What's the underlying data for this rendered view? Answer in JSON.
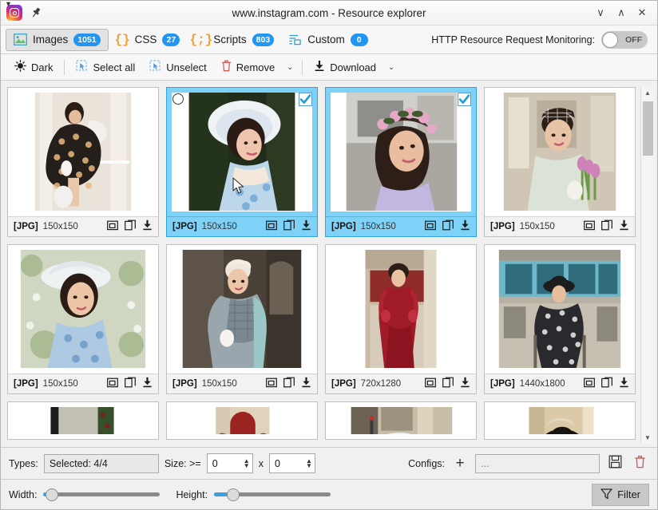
{
  "window": {
    "title": "www.instagram.com - Resource explorer",
    "app_icon": "instagram-logo-icon",
    "pin_icon": "pin-icon",
    "controls": [
      {
        "name": "minimize-button",
        "glyph": "∨"
      },
      {
        "name": "maximize-button",
        "glyph": "∧"
      },
      {
        "name": "close-button",
        "glyph": "✕"
      }
    ]
  },
  "tabs": [
    {
      "id": "images",
      "label": "Images",
      "count": "1051",
      "icon": "image-icon",
      "active": true
    },
    {
      "id": "css",
      "label": "CSS",
      "count": "27",
      "icon": "braces-icon",
      "active": false
    },
    {
      "id": "scripts",
      "label": "Scripts",
      "count": "803",
      "icon": "braces-icon",
      "active": false
    },
    {
      "id": "custom",
      "label": "Custom",
      "count": "0",
      "icon": "list-icon",
      "active": false
    }
  ],
  "http_monitoring": {
    "label": "HTTP Resource Request Monitoring:",
    "state_label": "OFF",
    "enabled": false
  },
  "toolbar": {
    "dark_label": "Dark",
    "select_all_label": "Select all",
    "unselect_label": "Unselect",
    "remove_label": "Remove",
    "download_label": "Download",
    "dropdown_glyph": "⌄"
  },
  "cards": [
    {
      "type": "[JPG]",
      "dims": "150x150",
      "selected": false,
      "checked": false,
      "scene": "dress-floral",
      "cursor": false
    },
    {
      "type": "[JPG]",
      "dims": "150x150",
      "selected": true,
      "checked": true,
      "scene": "white-hat",
      "cursor": true
    },
    {
      "type": "[JPG]",
      "dims": "150x150",
      "selected": true,
      "checked": true,
      "scene": "flower-crown",
      "cursor": false
    },
    {
      "type": "[JPG]",
      "dims": "150x150",
      "selected": false,
      "checked": false,
      "scene": "tulips",
      "cursor": false
    },
    {
      "type": "[JPG]",
      "dims": "150x150",
      "selected": false,
      "checked": false,
      "scene": "garden-hat",
      "cursor": false
    },
    {
      "type": "[JPG]",
      "dims": "150x150",
      "selected": false,
      "checked": false,
      "scene": "gray-coat",
      "cursor": false
    },
    {
      "type": "[JPG]",
      "dims": "720x1280",
      "selected": false,
      "checked": false,
      "scene": "red-dress",
      "cursor": false
    },
    {
      "type": "[JPG]",
      "dims": "1440x1800",
      "selected": false,
      "checked": false,
      "scene": "street-cafe",
      "cursor": false
    }
  ],
  "partial_cards": [
    {
      "scene": "window-green"
    },
    {
      "scene": "red-door"
    },
    {
      "scene": "white-hat-street"
    },
    {
      "scene": "black-hat"
    }
  ],
  "card_icons": {
    "open_icon": "open-in-window-icon",
    "copy_icon": "copy-icon",
    "download_icon": "download-icon"
  },
  "scrollbar": {
    "up_glyph": "▲",
    "down_glyph": "▼"
  },
  "filters": {
    "types_label": "Types:",
    "types_value": "Selected: 4/4",
    "size_label": "Size: >=",
    "size_width": "0",
    "size_x": "x",
    "size_height": "0",
    "configs_label": "Configs:",
    "configs_add_glyph": "+",
    "configs_value": "...",
    "save_icon": "save-icon",
    "delete_icon": "trash-icon"
  },
  "sliders": {
    "width_label": "Width:",
    "width_percent": 3,
    "height_label": "Height:",
    "height_percent": 12,
    "filter_button_label": "Filter",
    "filter_icon": "funnel-icon"
  },
  "colors": {
    "accent": "#2196f3",
    "selection": "#7ed2f7",
    "danger": "#d9534f",
    "toolbar_bg": "#f7f7f7"
  }
}
